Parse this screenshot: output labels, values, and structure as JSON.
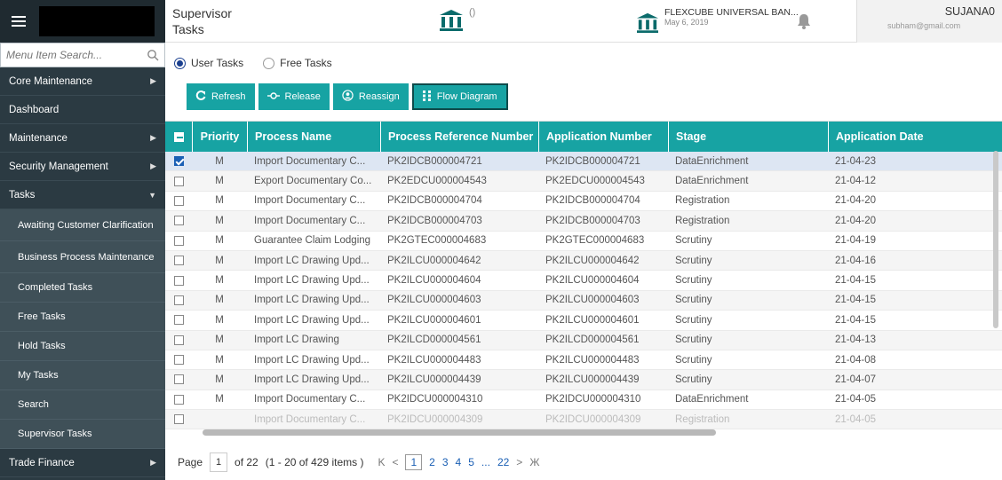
{
  "sidebar": {
    "search_placeholder": "Menu Item Search...",
    "items": [
      {
        "label": "Core Maintenance",
        "arrow": "▶"
      },
      {
        "label": "Dashboard",
        "arrow": ""
      },
      {
        "label": "Maintenance",
        "arrow": "▶"
      },
      {
        "label": "Security Management",
        "arrow": "▶"
      },
      {
        "label": "Tasks",
        "arrow": "▼"
      }
    ],
    "sub_items": [
      "Awaiting Customer Clarification",
      "Business Process Maintenance",
      "Completed Tasks",
      "Free Tasks",
      "Hold Tasks",
      "My Tasks",
      "Search",
      "Supervisor Tasks"
    ],
    "trade_finance": {
      "label": "Trade Finance",
      "arrow": "▶"
    }
  },
  "header": {
    "title": "Supervisor Tasks",
    "entity_parens": "()",
    "branch_name": "FLEXCUBE UNIVERSAL BAN...",
    "branch_date": "May 6, 2019",
    "user_name": "SUJANA0",
    "user_email": "subham@gmail.com"
  },
  "filters": {
    "user_tasks": "User Tasks",
    "free_tasks": "Free Tasks",
    "selected": "User Tasks"
  },
  "toolbar": {
    "refresh": "Refresh",
    "release": "Release",
    "reassign": "Reassign",
    "flow_diagram": "Flow Diagram"
  },
  "grid": {
    "columns": [
      "Priority",
      "Process Name",
      "Process Reference Number",
      "Application Number",
      "Stage",
      "Application Date"
    ],
    "rows": [
      {
        "checked": true,
        "priority": "M",
        "process": "Import Documentary C...",
        "ref": "PK2IDCB000004721",
        "app": "PK2IDCB000004721",
        "stage": "DataEnrichment",
        "date": "21-04-23"
      },
      {
        "checked": false,
        "priority": "M",
        "process": "Export Documentary Co...",
        "ref": "PK2EDCU000004543",
        "app": "PK2EDCU000004543",
        "stage": "DataEnrichment",
        "date": "21-04-12"
      },
      {
        "checked": false,
        "priority": "M",
        "process": "Import Documentary C...",
        "ref": "PK2IDCB000004704",
        "app": "PK2IDCB000004704",
        "stage": "Registration",
        "date": "21-04-20"
      },
      {
        "checked": false,
        "priority": "M",
        "process": "Import Documentary C...",
        "ref": "PK2IDCB000004703",
        "app": "PK2IDCB000004703",
        "stage": "Registration",
        "date": "21-04-20"
      },
      {
        "checked": false,
        "priority": "M",
        "process": "Guarantee Claim Lodging",
        "ref": "PK2GTEC000004683",
        "app": "PK2GTEC000004683",
        "stage": "Scrutiny",
        "date": "21-04-19"
      },
      {
        "checked": false,
        "priority": "M",
        "process": "Import LC Drawing Upd...",
        "ref": "PK2ILCU000004642",
        "app": "PK2ILCU000004642",
        "stage": "Scrutiny",
        "date": "21-04-16"
      },
      {
        "checked": false,
        "priority": "M",
        "process": "Import LC Drawing Upd...",
        "ref": "PK2ILCU000004604",
        "app": "PK2ILCU000004604",
        "stage": "Scrutiny",
        "date": "21-04-15"
      },
      {
        "checked": false,
        "priority": "M",
        "process": "Import LC Drawing Upd...",
        "ref": "PK2ILCU000004603",
        "app": "PK2ILCU000004603",
        "stage": "Scrutiny",
        "date": "21-04-15"
      },
      {
        "checked": false,
        "priority": "M",
        "process": "Import LC Drawing Upd...",
        "ref": "PK2ILCU000004601",
        "app": "PK2ILCU000004601",
        "stage": "Scrutiny",
        "date": "21-04-15"
      },
      {
        "checked": false,
        "priority": "M",
        "process": "Import LC Drawing",
        "ref": "PK2ILCD000004561",
        "app": "PK2ILCD000004561",
        "stage": "Scrutiny",
        "date": "21-04-13"
      },
      {
        "checked": false,
        "priority": "M",
        "process": "Import LC Drawing Upd...",
        "ref": "PK2ILCU000004483",
        "app": "PK2ILCU000004483",
        "stage": "Scrutiny",
        "date": "21-04-08"
      },
      {
        "checked": false,
        "priority": "M",
        "process": "Import LC Drawing Upd...",
        "ref": "PK2ILCU000004439",
        "app": "PK2ILCU000004439",
        "stage": "Scrutiny",
        "date": "21-04-07"
      },
      {
        "checked": false,
        "priority": "M",
        "process": "Import Documentary C...",
        "ref": "PK2IDCU000004310",
        "app": "PK2IDCU000004310",
        "stage": "DataEnrichment",
        "date": "21-04-05"
      },
      {
        "checked": false,
        "priority": "",
        "process": "Import Documentary C...",
        "ref": "PK2IDCU000004309",
        "app": "PK2IDCU000004309",
        "stage": "Registration",
        "date": "21-04-05"
      }
    ]
  },
  "pager": {
    "page_label": "Page",
    "current": "1",
    "of_total": "of 22",
    "range": "(1 - 20 of 429 items )",
    "first": "K",
    "prev": "<",
    "pages": [
      "1",
      "2",
      "3",
      "4",
      "5",
      "...",
      "22"
    ],
    "next": ">",
    "last": "Ж"
  }
}
